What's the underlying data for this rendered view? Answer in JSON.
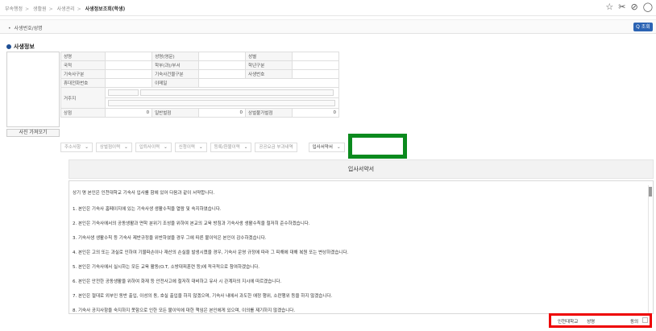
{
  "breadcrumb": [
    "부속행정",
    "생활원",
    "사생관리",
    "사생정보조회(학생)"
  ],
  "top_icons": [
    "star-icon",
    "tools-icon",
    "help-icon",
    "close-icon"
  ],
  "search": {
    "label": "사생번호/성명",
    "button": "Q 조회"
  },
  "section_title": "사생정보",
  "photo_button": "사진 가져오기",
  "info": {
    "name": "성명",
    "name_en": "성명(영문)",
    "gender": "성별",
    "nationality": "국적",
    "dept": "학부(과)/부서",
    "grade": "학년구분",
    "dorm_type": "기숙사구분",
    "building": "기숙사건물구분",
    "student_no": "사생번호",
    "mobile": "휴대전화번호",
    "email": "이메일",
    "address": "거주지",
    "merit": "상점",
    "merit_value": "0",
    "general_demerit": "일반벌점",
    "general_demerit_value": "0",
    "hygiene_demerit": "상벌불가벌점",
    "hygiene_demerit_value": "0"
  },
  "tabs": [
    "주소사항",
    "상벌점이력",
    "입퇴사이력",
    "신청이력",
    "등록/환불이력",
    "공공요금 부과내역",
    "입사서약서"
  ],
  "pledge": {
    "title": "입사서약서",
    "lines": [
      "상기 명 본인은 인천대학교 기숙사 입사를 함에 있어 다음과 같이 서약합니다.",
      "1. 본인은 기숙사 홈페이지에 있는 기숙사생 생활수칙을 열람 및 숙지하였습니다.",
      "2. 본인은 기숙사에서의 공동생활과 면학 분위기 조성을 위하여 본교의 교육 방침과 기숙사생 생활수칙을 철저히 준수하겠습니다.",
      "3. 기숙사생 생활수칙 등 기숙사 제반규정을 위반하였을 경우 그에 따른 불이익은 본인이 감수하겠습니다.",
      "4. 본인은 고의 또는 과실로 인하여 기물파손이나 재산의 손실을 발생시켰을 경우, 기숙사 운영 규정에 따라 그 피해에 대해 복원 또는 변상하겠습니다.",
      "5. 본인은 기숙사에서 실시하는 모든 교육 활동(O.T, 소방대피훈련 등)에 적극적으로 참여하겠습니다.",
      "6. 본인은 안전한 공동생활을 위하여 화재 등 안전사고에 철저히 대비하고 유사 시 관계자의 지시에 따르겠습니다.",
      "7. 본인은 절대로 외부인 동반 출입, 이성의 동, 호실 출입을 하지 않겠으며, 기숙사 내에서 과도한 애정 행위, 소란행위 등을 하지 않겠습니다.",
      "8. 기숙사 공지사항을 숙지하지 못함으로 인한 모든 불이익에 대한 책임은 본인에게 있으며, 이의를 제기하지 않겠습니다."
    ]
  },
  "agree": {
    "school": "인천대학교",
    "name_label": "성명",
    "agree_label": "동의"
  }
}
